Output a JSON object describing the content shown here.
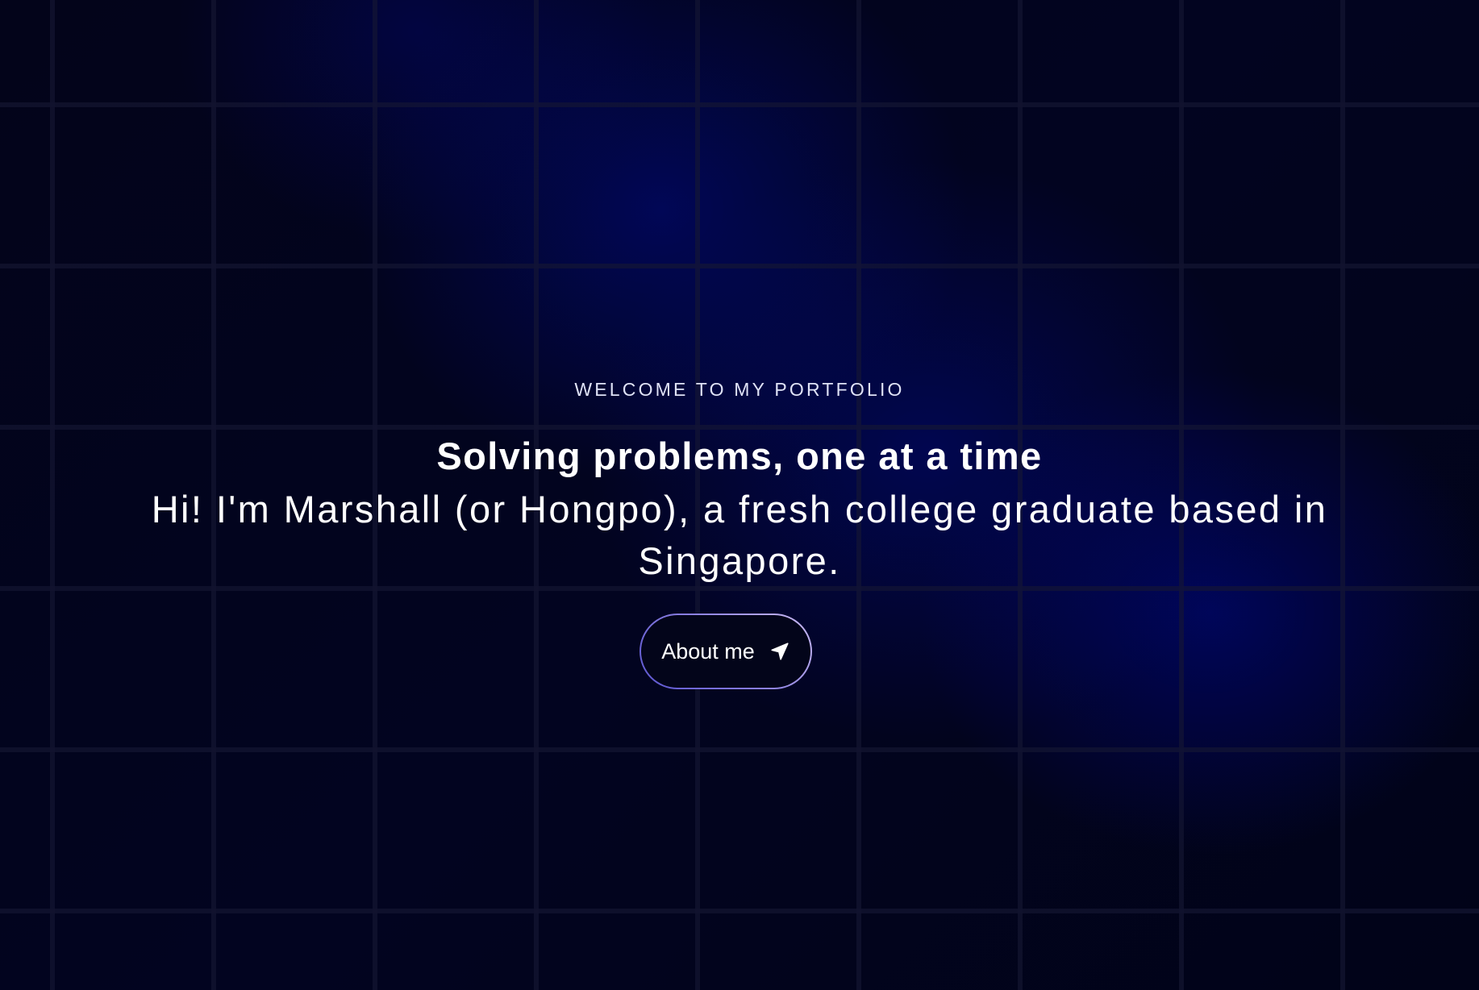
{
  "hero": {
    "eyebrow": "WELCOME TO MY PORTFOLIO",
    "title": "Solving problems, one at a time",
    "subtitle": "Hi! I'm Marshall (or Hongpo), a fresh college graduate based in Singapore.",
    "cta": {
      "label": "About me",
      "icon": "navigation-arrow-icon"
    }
  },
  "theme": {
    "background": "#02031a",
    "glow": "#000a78",
    "button_border_start": "#5b55d0",
    "button_border_end": "#cbbcf2",
    "text": "#ffffff",
    "eyebrow_text": "#dfe2f6"
  }
}
